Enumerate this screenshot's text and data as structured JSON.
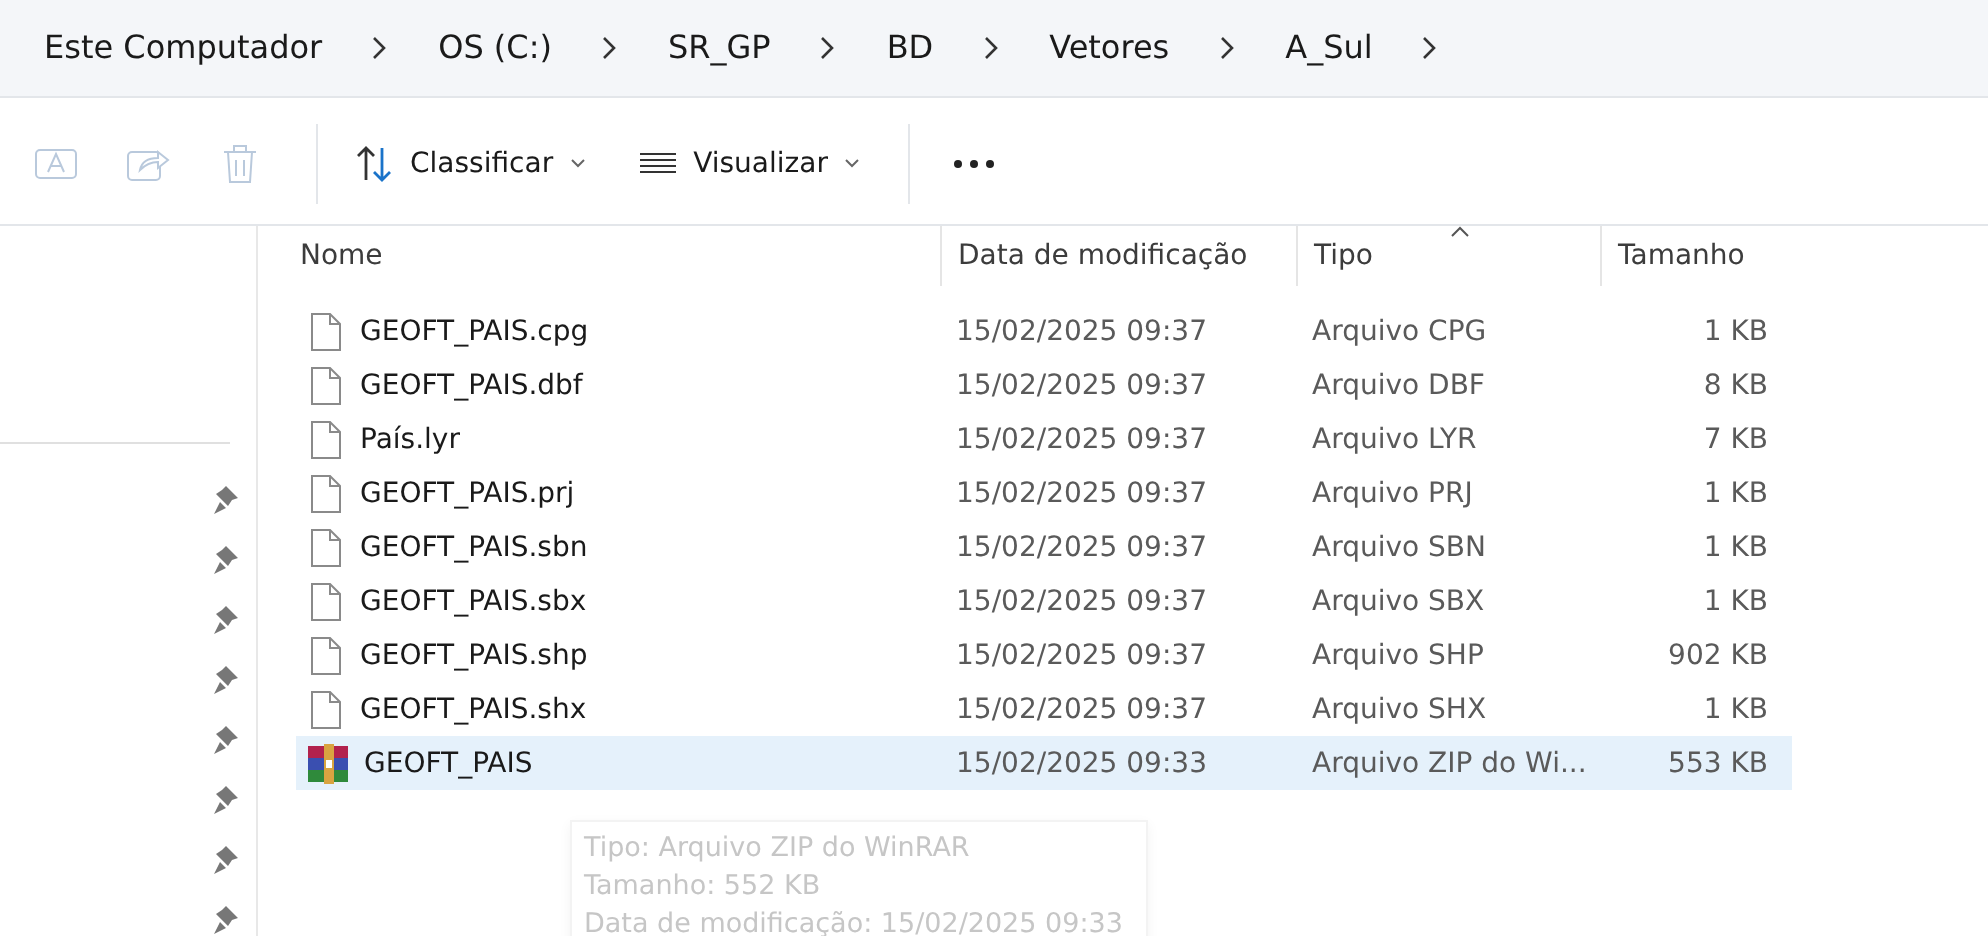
{
  "breadcrumb": [
    "Este Computador",
    "OS (C:)",
    "SR_GP",
    "BD",
    "Vetores",
    "A_Sul"
  ],
  "toolbar": [
    {
      "kind": "rename",
      "disabled": true
    },
    {
      "kind": "share",
      "disabled": true
    },
    {
      "kind": "delete",
      "disabled": true
    },
    {
      "kind": "sort",
      "label": "Classificar",
      "disabled": false
    },
    {
      "kind": "view",
      "label": "Visualizar",
      "disabled": false
    },
    {
      "kind": "more",
      "disabled": false
    }
  ],
  "columns": [
    {
      "label": "Nome",
      "sorted": false
    },
    {
      "label": "Data de modificação",
      "sorted": false
    },
    {
      "label": "Tipo",
      "sorted": true
    },
    {
      "label": "Tamanho",
      "sorted": false
    }
  ],
  "rows": [
    {
      "kind": "file",
      "name": "GEOFT_PAIS.cpg",
      "date": "15/02/2025 09:37",
      "type": "Arquivo CPG",
      "size": "1 KB",
      "selected": false
    },
    {
      "kind": "file",
      "name": "GEOFT_PAIS.dbf",
      "date": "15/02/2025 09:37",
      "type": "Arquivo DBF",
      "size": "8 KB",
      "selected": false
    },
    {
      "kind": "file",
      "name": "País.lyr",
      "date": "15/02/2025 09:37",
      "type": "Arquivo LYR",
      "size": "7 KB",
      "selected": false
    },
    {
      "kind": "file",
      "name": "GEOFT_PAIS.prj",
      "date": "15/02/2025 09:37",
      "type": "Arquivo PRJ",
      "size": "1 KB",
      "selected": false
    },
    {
      "kind": "file",
      "name": "GEOFT_PAIS.sbn",
      "date": "15/02/2025 09:37",
      "type": "Arquivo SBN",
      "size": "1 KB",
      "selected": false
    },
    {
      "kind": "file",
      "name": "GEOFT_PAIS.sbx",
      "date": "15/02/2025 09:37",
      "type": "Arquivo SBX",
      "size": "1 KB",
      "selected": false
    },
    {
      "kind": "file",
      "name": "GEOFT_PAIS.shp",
      "date": "15/02/2025 09:37",
      "type": "Arquivo SHP",
      "size": "902 KB",
      "selected": false
    },
    {
      "kind": "file",
      "name": "GEOFT_PAIS.shx",
      "date": "15/02/2025 09:37",
      "type": "Arquivo SHX",
      "size": "1 KB",
      "selected": false
    },
    {
      "kind": "archive",
      "name": "GEOFT_PAIS",
      "date": "15/02/2025 09:33",
      "type": "Arquivo ZIP do Wi...",
      "size": "553 KB",
      "selected": true
    }
  ],
  "tooltip": [
    "Tipo: Arquivo ZIP do WinRAR",
    "Tamanho: 552 KB",
    "Data de modificação: 15/02/2025 09:33"
  ]
}
